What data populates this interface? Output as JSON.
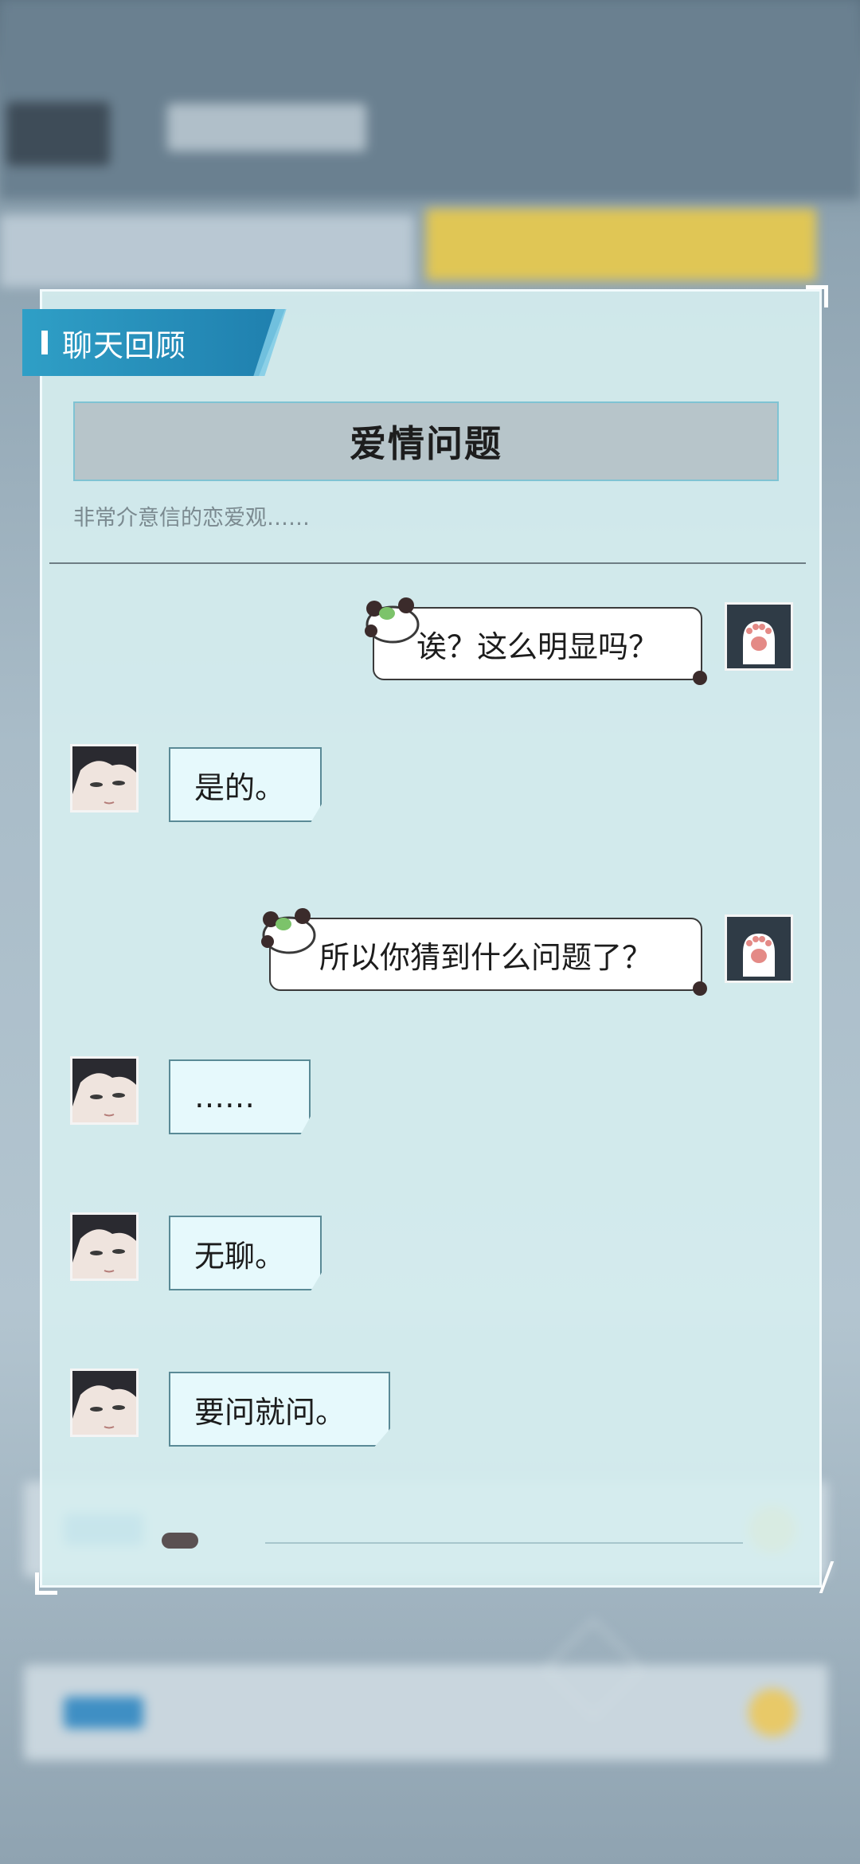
{
  "panel": {
    "header_label": "聊天回顾",
    "topic_title": "爱情问题",
    "topic_subtitle": "非常介意信的恋爱观……"
  },
  "messages": [
    {
      "sender": "user",
      "text": "诶？这么明显吗？"
    },
    {
      "sender": "npc",
      "text": "是的。"
    },
    {
      "sender": "user",
      "text": "所以你猜到什么问题了？"
    },
    {
      "sender": "npc",
      "text": "……"
    },
    {
      "sender": "npc",
      "text": "无聊。"
    },
    {
      "sender": "npc",
      "text": "要问就问。"
    }
  ],
  "colors": {
    "header_tab": "#2f9fc6",
    "panel_bg": "#d6eef0",
    "npc_bubble": "#e6f9fc",
    "user_bubble": "#ffffff"
  },
  "icons": {
    "user_avatar": "cat-paw-icon",
    "npc_avatar": "character-portrait",
    "bubble_decoration": "panda-sticker-icon"
  }
}
